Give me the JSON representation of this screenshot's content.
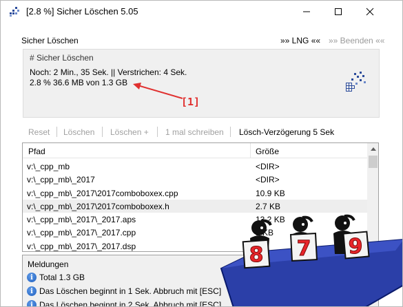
{
  "window": {
    "title": "[2.8 %] Sicher Löschen 5.05",
    "controls": {
      "minimize": "minimize-icon",
      "maximize": "maximize-icon",
      "close": "close-icon"
    }
  },
  "menu": {
    "app": "Sicher Löschen",
    "lng": "»» LNG ««",
    "beenden": "»» Beenden ««"
  },
  "progress_group": {
    "title": "# Sicher Löschen",
    "line1": "Noch: 2 Min., 35 Sek. || Verstrichen: 4 Sek.",
    "line2": "2.8 % 36.6 MB von 1.3 GB",
    "progress_percent": 2.8
  },
  "annotation": {
    "label": "[1]",
    "color": "#e0302f"
  },
  "toolbar": {
    "reset": "Reset",
    "loeschen": "Löschen",
    "loeschen_plus": "Löschen +",
    "einmal": "1 mal schreiben",
    "delay": "Lösch-Verzögerung 5 Sek"
  },
  "list": {
    "columns": {
      "path": "Pfad",
      "size": "Größe"
    },
    "rows": [
      {
        "path": "v:\\_cpp_mb",
        "size": "<DIR>"
      },
      {
        "path": "v:\\_cpp_mb\\_2017",
        "size": "<DIR>"
      },
      {
        "path": "v:\\_cpp_mb\\_2017\\2017comboboxex.cpp",
        "size": "10.9 KB"
      },
      {
        "path": "v:\\_cpp_mb\\_2017\\2017comboboxex.h",
        "size": "2.7 KB"
      },
      {
        "path": "v:\\_cpp_mb\\_2017\\_2017.aps",
        "size": "13.2 KB"
      },
      {
        "path": "v:\\_cpp_mb\\_2017\\_2017.cpp",
        "size": "1 KB"
      },
      {
        "path": "v:\\_cpp_mb\\_2017\\_2017.dsp",
        "size": "KB"
      }
    ],
    "selected_index": 3
  },
  "messages": {
    "title": "Meldungen",
    "items": [
      "Total 1.3 GB",
      "Das Löschen beginnt in 1 Sek. Abbruch mit [ESC]",
      "Das Löschen beginnt in 2 Sek. Abbruch mit [ESC]"
    ]
  },
  "mascots": {
    "scores": [
      "8",
      "7",
      "9"
    ],
    "score_color": "#e8252a",
    "table_color": "#2b3fa8"
  }
}
